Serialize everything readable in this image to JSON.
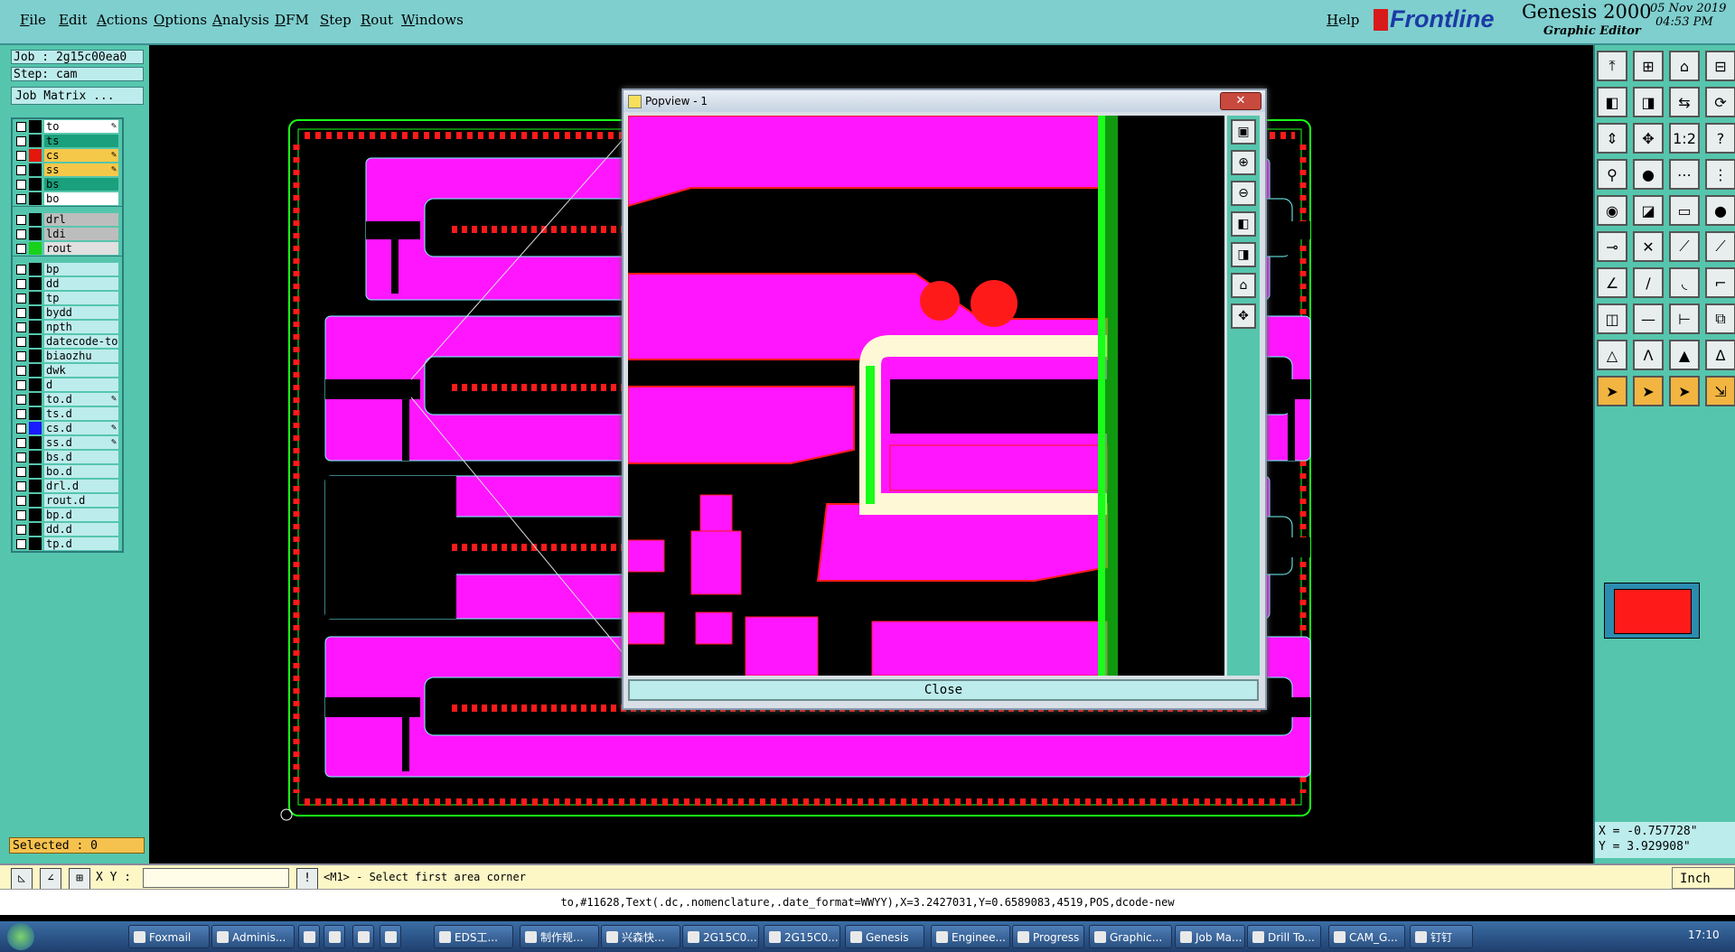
{
  "menu": {
    "items": [
      "File",
      "Edit",
      "Actions",
      "Options",
      "Analysis",
      "DFM",
      "Step",
      "Rout",
      "Windows"
    ],
    "help": "Help"
  },
  "brand": {
    "logo": "Frontline",
    "product": "Genesis 2000",
    "subtitle": "Graphic Editor",
    "date": "05 Nov 2019",
    "time": "04:53 PM"
  },
  "job": {
    "job_label": "Job : 2g15c00ea0",
    "step_label": "Step: cam",
    "matrix_button": "Job Matrix ..."
  },
  "layers": {
    "group1": [
      {
        "name": "to",
        "bg": "#ffffff",
        "color": "#000000",
        "mark": "✎"
      },
      {
        "name": "ts",
        "bg": "#1aa07c",
        "color": "#000000",
        "mark": ""
      },
      {
        "name": "cs",
        "bg": "#f5c84a",
        "color": "#e3170b",
        "mark": "✎"
      },
      {
        "name": "ss",
        "bg": "#f5c84a",
        "color": "#000000",
        "mark": "✎"
      },
      {
        "name": "bs",
        "bg": "#1aa07c",
        "color": "#000000",
        "mark": ""
      },
      {
        "name": "bo",
        "bg": "#ffffff",
        "color": "#000000",
        "mark": ""
      }
    ],
    "group2": [
      {
        "name": "drl",
        "bg": "#bdbdbd",
        "color": "#000000",
        "mark": ""
      },
      {
        "name": "ldi",
        "bg": "#bdbdbd",
        "color": "#000000",
        "mark": ""
      },
      {
        "name": "rout",
        "bg": "#e0e0e0",
        "color": "#19d11a",
        "mark": ""
      }
    ],
    "group3": [
      {
        "name": "bp",
        "bg": "#bdecec",
        "color": "#000000",
        "mark": ""
      },
      {
        "name": "dd",
        "bg": "#bdecec",
        "color": "#000000",
        "mark": ""
      },
      {
        "name": "tp",
        "bg": "#bdecec",
        "color": "#000000",
        "mark": ""
      },
      {
        "name": "bydd",
        "bg": "#bdecec",
        "color": "#000000",
        "mark": ""
      },
      {
        "name": "npth",
        "bg": "#bdecec",
        "color": "#000000",
        "mark": ""
      },
      {
        "name": "datecode-to",
        "bg": "#bdecec",
        "color": "#000000",
        "mark": ""
      },
      {
        "name": "biaozhu",
        "bg": "#bdecec",
        "color": "#000000",
        "mark": ""
      },
      {
        "name": "dwk",
        "bg": "#bdecec",
        "color": "#000000",
        "mark": ""
      },
      {
        "name": "d",
        "bg": "#bdecec",
        "color": "#000000",
        "mark": ""
      },
      {
        "name": "to.d",
        "bg": "#bdecec",
        "color": "#000000",
        "mark": "✎"
      },
      {
        "name": "ts.d",
        "bg": "#bdecec",
        "color": "#000000",
        "mark": ""
      },
      {
        "name": "cs.d",
        "bg": "#bdecec",
        "color": "#1a1aff",
        "mark": "✎"
      },
      {
        "name": "ss.d",
        "bg": "#bdecec",
        "color": "#000000",
        "mark": "✎"
      },
      {
        "name": "bs.d",
        "bg": "#bdecec",
        "color": "#000000",
        "mark": ""
      },
      {
        "name": "bo.d",
        "bg": "#bdecec",
        "color": "#000000",
        "mark": ""
      },
      {
        "name": "drl.d",
        "bg": "#bdecec",
        "color": "#000000",
        "mark": ""
      },
      {
        "name": "rout.d",
        "bg": "#bdecec",
        "color": "#000000",
        "mark": ""
      },
      {
        "name": "bp.d",
        "bg": "#bdecec",
        "color": "#000000",
        "mark": ""
      },
      {
        "name": "dd.d",
        "bg": "#bdecec",
        "color": "#000000",
        "mark": ""
      },
      {
        "name": "tp.d",
        "bg": "#bdecec",
        "color": "#000000",
        "mark": ""
      }
    ]
  },
  "selected": "Selected : 0",
  "coords": {
    "x": "X = -0.757728\"",
    "y": "Y = 3.929908\""
  },
  "cmdline": {
    "xy_label": "X Y :",
    "xy_value": "",
    "prompt": "<M1> - Select first area corner",
    "units": "Inch"
  },
  "status_line": "to,#11628,Text(.dc,.nomenclature,.date_format=WWYY),X=3.2427031,Y=0.6589083,4519,POS,dcode-new",
  "popview": {
    "title": "Popview - 1",
    "close_button": "Close"
  },
  "taskbar": {
    "items": [
      "Foxmail",
      "Adminis...",
      "",
      "",
      "",
      "",
      "EDS工...",
      "制作规...",
      "兴森快...",
      "2G15C0...",
      "2G15C0...",
      "Genesis",
      "Enginee...",
      "Progress",
      "Graphic...",
      "Job Ma...",
      "Drill To...",
      "CAM_G...",
      "钉钉"
    ],
    "clock": "17:10"
  },
  "colors": {
    "copper": "#ff16ff",
    "pads": "#ff1a1a",
    "rout": "#19ff19",
    "outline": "#19ff19",
    "panel": "#55c6ad"
  }
}
